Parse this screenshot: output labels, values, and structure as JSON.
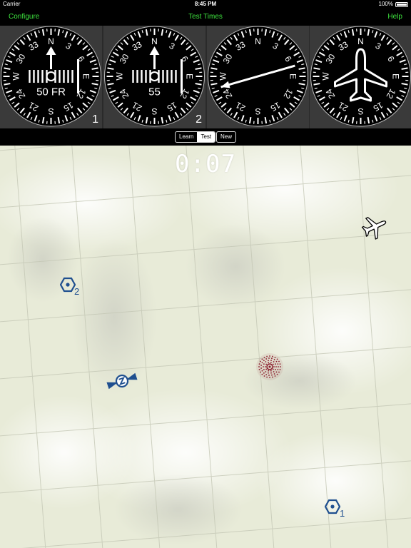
{
  "status": {
    "carrier": "Carrier",
    "time": "8:45 PM",
    "battery": "100%"
  },
  "nav": {
    "left": "Configure",
    "title": "Test Times",
    "right": "Help",
    "color": "#3ee33e"
  },
  "instruments": [
    {
      "type": "vor",
      "lettering": [
        "50",
        "FR"
      ],
      "number": "1"
    },
    {
      "type": "vor",
      "lettering": [
        "55"
      ],
      "number": "2"
    },
    {
      "type": "adf",
      "lettering": [],
      "number": ""
    },
    {
      "type": "heading",
      "lettering": [],
      "number": ""
    }
  ],
  "controls": {
    "segments": [
      "Learn",
      "Test"
    ],
    "active": "Test",
    "new_label": "New"
  },
  "map": {
    "timer": "0:07",
    "waypoints": [
      {
        "label": "2"
      },
      {
        "label": "1"
      }
    ],
    "icons": [
      "airplane-icon",
      "vor-station-icon",
      "ndb-target-icon"
    ],
    "colors": {
      "terrain": "#e9ecd9",
      "waypoint": "#1f4f8f",
      "target": "#8b1c2c"
    }
  }
}
